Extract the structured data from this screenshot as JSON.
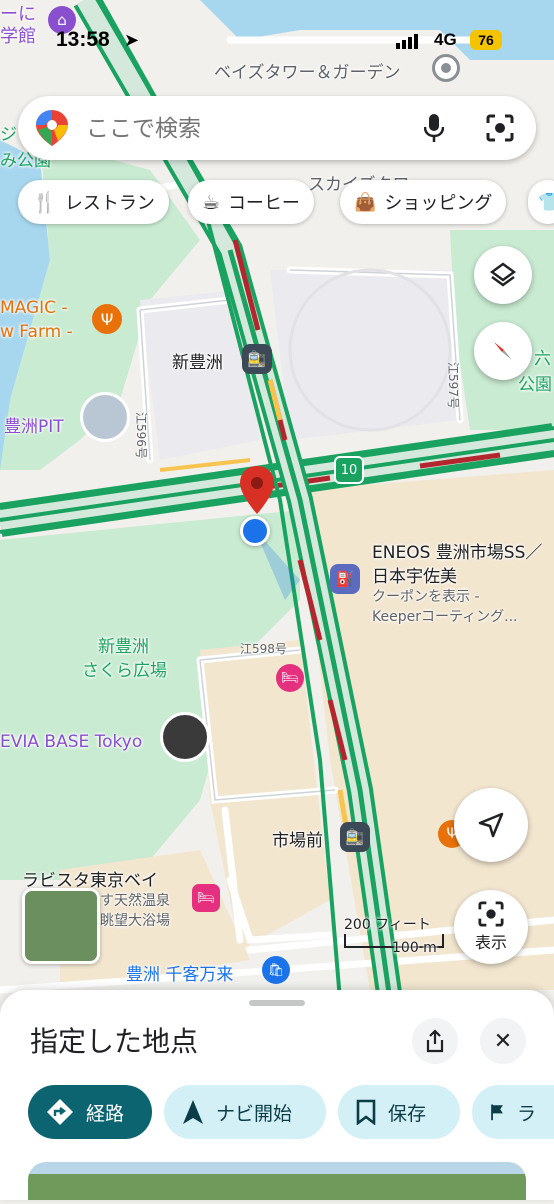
{
  "status_bar": {
    "time": "13:58",
    "network": "4G",
    "battery": "76"
  },
  "search": {
    "placeholder": "ここで検索"
  },
  "chips": [
    {
      "label": "レストラン",
      "icon": "fork-knife-icon"
    },
    {
      "label": "コーヒー",
      "icon": "coffee-cup-icon"
    },
    {
      "label": "ショッピング",
      "icon": "shopping-bag-icon"
    }
  ],
  "map_labels": {
    "top_left_1": "ーに",
    "top_left_2": "学館",
    "bays_tower": "ベイズタワー＆ガーデン",
    "skydeck": "スカイズクワ",
    "ji": "ジ",
    "mikoen": "み公園",
    "magic_1": "MAGIC -",
    "magic_2": "w Farm -",
    "shintoyosu": "新豊洲",
    "toyosupit": "豊洲PIT",
    "route_596": "江596号",
    "route_597": "江597号",
    "route_598": "江598号",
    "route_10": "10",
    "roku": "六",
    "koen": "公園",
    "eneos_1": "ENEOS 豊洲市場SS／",
    "eneos_2": "日本宇佐美",
    "eneos_3": "クーポンを表示 -",
    "eneos_4": "Keeperコーティング...",
    "sakura_1": "新豊洲",
    "sakura_2": "さくら広場",
    "evia": "EVIA BASE Tokyo",
    "shijomae": "市場前",
    "labista": "ラビスタ東京ベイ",
    "onsen_1": "す天然温泉",
    "onsen_2": "眺望大浴場",
    "senkyaku": "豊洲 千客万来",
    "scale_ft": "200 フィート",
    "scale_m": "100 m"
  },
  "map_buttons": {
    "show_label": "表示"
  },
  "sheet": {
    "title": "指定した地点",
    "actions": [
      {
        "label": "経路",
        "icon": "directions-icon"
      },
      {
        "label": "ナビ開始",
        "icon": "navigation-arrow-icon"
      },
      {
        "label": "保存",
        "icon": "bookmark-icon"
      },
      {
        "label": "ラ",
        "icon": "flag-icon"
      }
    ]
  },
  "colors": {
    "accent_teal": "#0b6470",
    "light_chip": "#d3f0f7",
    "road_green": "#1aa260",
    "road_red": "#b3262d",
    "water": "#a7d7ee",
    "park": "#c9ebd2",
    "pin_red": "#d93025",
    "location_blue": "#1a73e8"
  }
}
